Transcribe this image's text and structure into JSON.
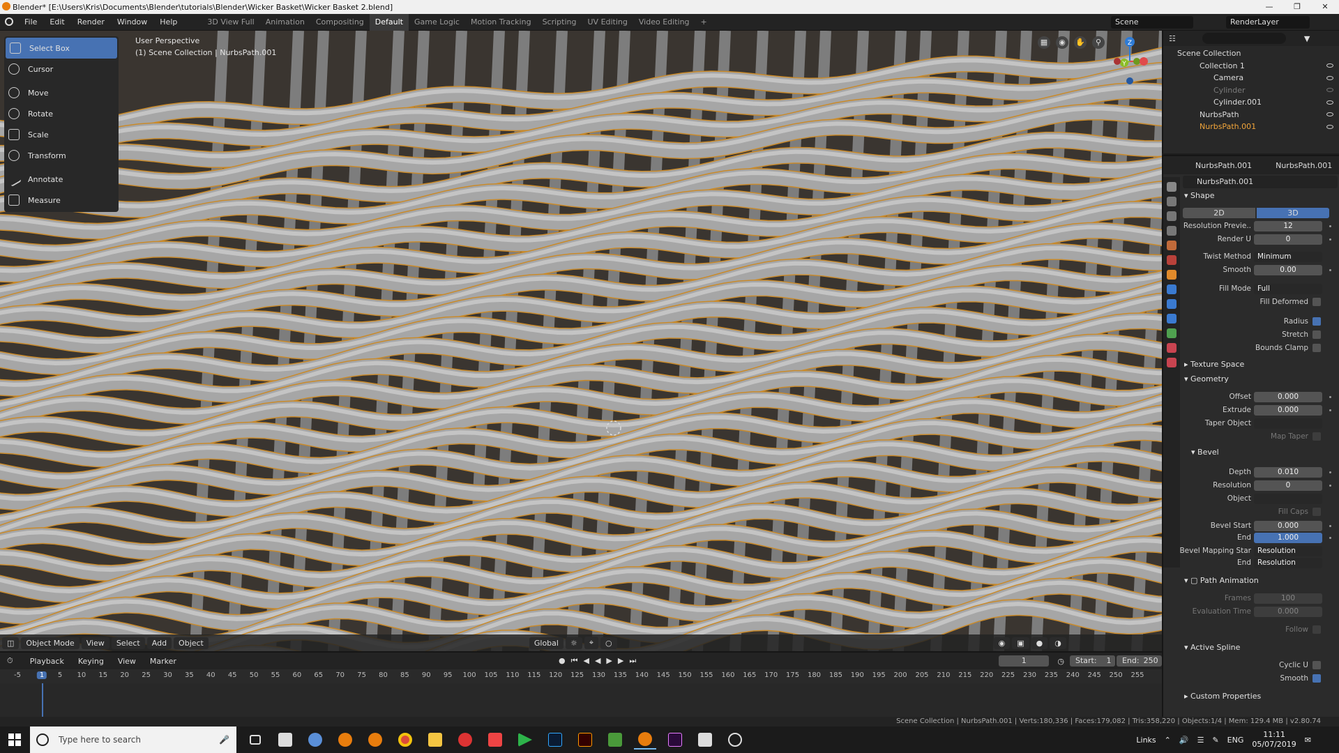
{
  "window": {
    "title": "Blender* [E:\\Users\\Kris\\Documents\\Blender\\tutorials\\Blender\\Wicker Basket\\Wicker Basket 2.blend]"
  },
  "menu": [
    "File",
    "Edit",
    "Render",
    "Window",
    "Help"
  ],
  "workspaces": [
    "3D View Full",
    "Animation",
    "Compositing",
    "Default",
    "Game Logic",
    "Motion Tracking",
    "Scripting",
    "UV Editing",
    "Video Editing"
  ],
  "active_workspace": "Default",
  "scene": {
    "label": "Scene",
    "render_layer": "RenderLayer"
  },
  "tools": [
    "Select Box",
    "Cursor",
    "Move",
    "Rotate",
    "Scale",
    "Transform",
    "Annotate",
    "Measure"
  ],
  "viewport": {
    "view_name": "User Perspective",
    "context": "(1) Scene Collection | NurbsPath.001",
    "mode": "Object Mode",
    "view": "View",
    "select": "Select",
    "add": "Add",
    "object": "Object",
    "orientation": "Global"
  },
  "gizmo_labels": {
    "z": "Z",
    "y": "Y"
  },
  "outliner": {
    "root": "Scene Collection",
    "items": [
      {
        "name": "Collection 1",
        "indent": 1
      },
      {
        "name": "Camera",
        "indent": 2
      },
      {
        "name": "Cylinder",
        "indent": 2,
        "hidden": true
      },
      {
        "name": "Cylinder.001",
        "indent": 2
      },
      {
        "name": "NurbsPath",
        "indent": 1
      },
      {
        "name": "NurbsPath.001",
        "indent": 1,
        "active": true
      }
    ]
  },
  "properties": {
    "object_name": "NurbsPath.001",
    "data_name": "NurbsPath.001",
    "datablock": "NurbsPath.001",
    "shape": {
      "title": "Shape",
      "dim2": "2D",
      "dim3": "3D",
      "resolution_preview_label": "Resolution Previe..",
      "resolution_preview": "12",
      "render_u_label": "Render U",
      "render_u": "0",
      "twist_method_label": "Twist Method",
      "twist_method": "Minimum",
      "smooth_label": "Smooth",
      "smooth": "0.00",
      "fill_mode_label": "Fill Mode",
      "fill_mode": "Full",
      "fill_deformed_label": "Fill Deformed",
      "radius_label": "Radius",
      "stretch_label": "Stretch",
      "bounds_clamp_label": "Bounds Clamp"
    },
    "texture_space": "Texture Space",
    "geometry": {
      "title": "Geometry",
      "offset_label": "Offset",
      "offset": "0.000",
      "extrude_label": "Extrude",
      "extrude": "0.000",
      "taper_label": "Taper Object",
      "map_taper_label": "Map Taper"
    },
    "bevel": {
      "title": "Bevel",
      "depth_label": "Depth",
      "depth": "0.010",
      "resolution_label": "Resolution",
      "resolution": "0",
      "object_label": "Object",
      "fill_caps_label": "Fill Caps",
      "bevel_start_label": "Bevel Start",
      "bevel_start": "0.000",
      "end_label": "End",
      "end": "1.000",
      "mapping_start_label": "Bevel Mapping Star",
      "mapping_start": "Resolution",
      "mapping_end_label": "End",
      "mapping_end": "Resolution"
    },
    "path_animation": {
      "title": "Path Animation",
      "frames_label": "Frames",
      "frames": "100",
      "eval_label": "Evaluation Time",
      "eval": "0.000",
      "follow_label": "Follow"
    },
    "active_spline": {
      "title": "Active Spline",
      "cyclic_label": "Cyclic U",
      "smooth_label": "Smooth"
    },
    "custom": "Custom Properties"
  },
  "timeline": {
    "playback": "Playback",
    "keying": "Keying",
    "view": "View",
    "marker": "Marker",
    "current_frame": "1",
    "start_label": "Start:",
    "start": "1",
    "end_label": "End:",
    "end": "250",
    "ticks": [
      "-5",
      "1",
      "5",
      "10",
      "15",
      "20",
      "25",
      "30",
      "35",
      "40",
      "45",
      "50",
      "55",
      "60",
      "65",
      "70",
      "75",
      "80",
      "85",
      "90",
      "95",
      "100",
      "105",
      "110",
      "115",
      "120",
      "125",
      "130",
      "135",
      "140",
      "145",
      "150",
      "155",
      "160",
      "165",
      "170",
      "175",
      "180",
      "185",
      "190",
      "195",
      "200",
      "205",
      "210",
      "215",
      "220",
      "225",
      "230",
      "235",
      "240",
      "245",
      "250",
      "255"
    ]
  },
  "status": "Scene Collection | NurbsPath.001 | Verts:180,336 | Faces:179,082 | Tris:358,220 | Objects:1/4 | Mem: 129.4 MB | v2.80.74",
  "taskbar": {
    "search_placeholder": "Type here to search",
    "links": "Links",
    "lang": "ENG",
    "time": "11:11",
    "date": "05/07/2019"
  }
}
